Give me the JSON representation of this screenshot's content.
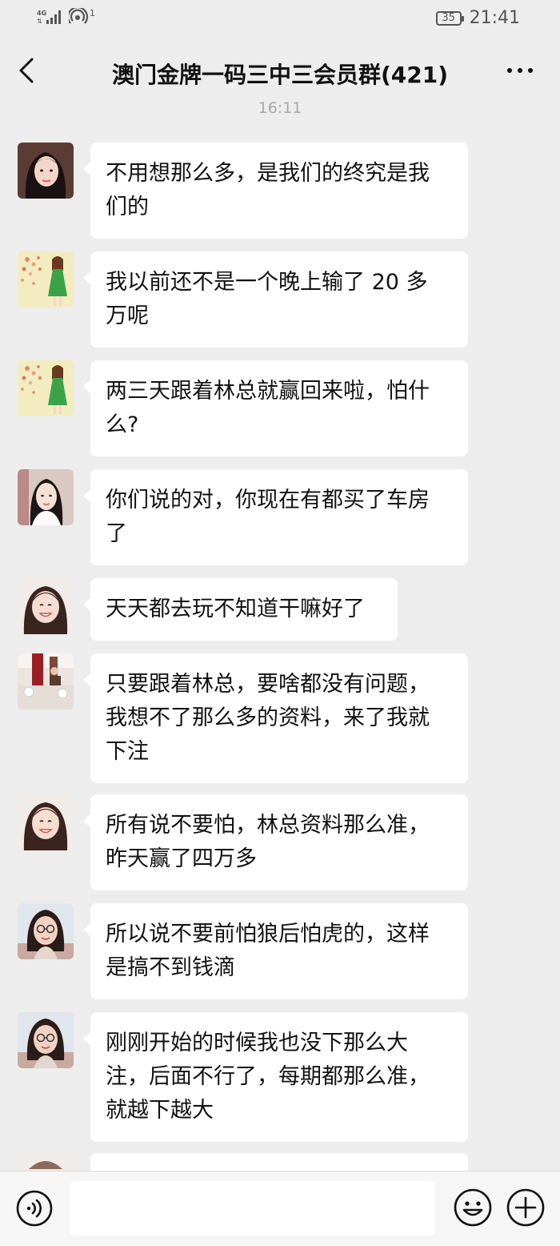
{
  "status_bar": {
    "network": "4G",
    "time": "21:41",
    "battery": "35",
    "hotspot_count": "1"
  },
  "header": {
    "title": "澳门金牌一码三中三会员群(421)"
  },
  "timestamp": "16:11",
  "messages": [
    {
      "avatar": "avatar-woman-long-hair",
      "lines": [
        "不用想那么多，是我们的终究是我",
        "们的"
      ]
    },
    {
      "avatar": "avatar-illustrated-girl-green-dress",
      "lines": [
        "我以前还不是一个晚上输了 20 多",
        "万呢"
      ]
    },
    {
      "avatar": "avatar-illustrated-girl-green-dress",
      "lines": [
        "两三天跟着林总就赢回来啦，怕什",
        "么?"
      ]
    },
    {
      "avatar": "avatar-woman-white-top",
      "lines": [
        "你们说的对，你现在有都买了车房",
        "了"
      ]
    },
    {
      "avatar": "avatar-smiling-woman",
      "lines": [
        "天天都去玩不知道干嘛好了"
      ]
    },
    {
      "avatar": "avatar-group-red-room",
      "lines": [
        "只要跟着林总，要啥都没有问题，",
        "我想不了那么多的资料，来了我就",
        "下注"
      ]
    },
    {
      "avatar": "avatar-smiling-woman",
      "lines": [
        "所有说不要怕，林总资料那么准，",
        "昨天赢了四万多"
      ]
    },
    {
      "avatar": "avatar-woman-glasses",
      "lines": [
        "所以说不要前怕狼后怕虎的，这样",
        "是搞不到钱滴"
      ]
    },
    {
      "avatar": "avatar-woman-glasses",
      "lines": [
        "刚刚开始的时候我也没下那么大",
        "注，后面不行了，每期都那么准，",
        "就越下越大"
      ]
    }
  ],
  "input": {
    "value": "",
    "placeholder": ""
  },
  "colors": {
    "background": "#ededed",
    "bubble": "#ffffff",
    "text": "#111111",
    "timestamp": "#a8a8a8"
  }
}
